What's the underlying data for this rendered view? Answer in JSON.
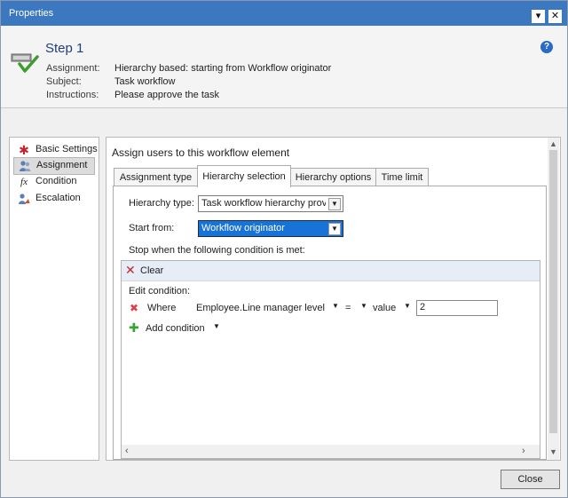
{
  "window": {
    "title": "Properties",
    "buttons": {
      "dropdown": "▾",
      "close": "✕"
    }
  },
  "header": {
    "step_title": "Step 1",
    "help": "?",
    "fields": [
      {
        "label": "Assignment:",
        "value": "Hierarchy based: starting from Workflow originator"
      },
      {
        "label": "Subject:",
        "value": "Task workflow"
      },
      {
        "label": "Instructions:",
        "value": "Please approve the task"
      }
    ]
  },
  "nav": {
    "items": [
      {
        "label": "Basic Settings",
        "icon": "asterisk-icon",
        "glyph": "✱"
      },
      {
        "label": "Assignment",
        "icon": "users-icon",
        "glyph": ""
      },
      {
        "label": "Condition",
        "icon": "function-icon",
        "glyph": "fx"
      },
      {
        "label": "Escalation",
        "icon": "escalation-icon",
        "glyph": ""
      }
    ],
    "selected": "Assignment"
  },
  "panel": {
    "title": "Assign users to this workflow element",
    "tabs": [
      "Assignment type",
      "Hierarchy selection",
      "Hierarchy options",
      "Time limit"
    ],
    "active_tab": "Hierarchy selection",
    "hierarchy_type": {
      "label": "Hierarchy type:",
      "value": "Task workflow hierarchy prov"
    },
    "start_from": {
      "label": "Start from:",
      "value": "Workflow originator"
    },
    "stop_condition_label": "Stop when the following condition is met:",
    "condition": {
      "clear_label": "Clear",
      "edit_label": "Edit condition:",
      "where_label": "Where",
      "field": "Employee.Line manager level",
      "operator": "=",
      "value_type": "value",
      "value": "2",
      "add_label": "Add condition"
    }
  },
  "footer": {
    "close_label": "Close"
  },
  "colors": {
    "titlebar": "#3b78c0",
    "accent": "#1873d8",
    "step_title": "#1f3f7a"
  }
}
